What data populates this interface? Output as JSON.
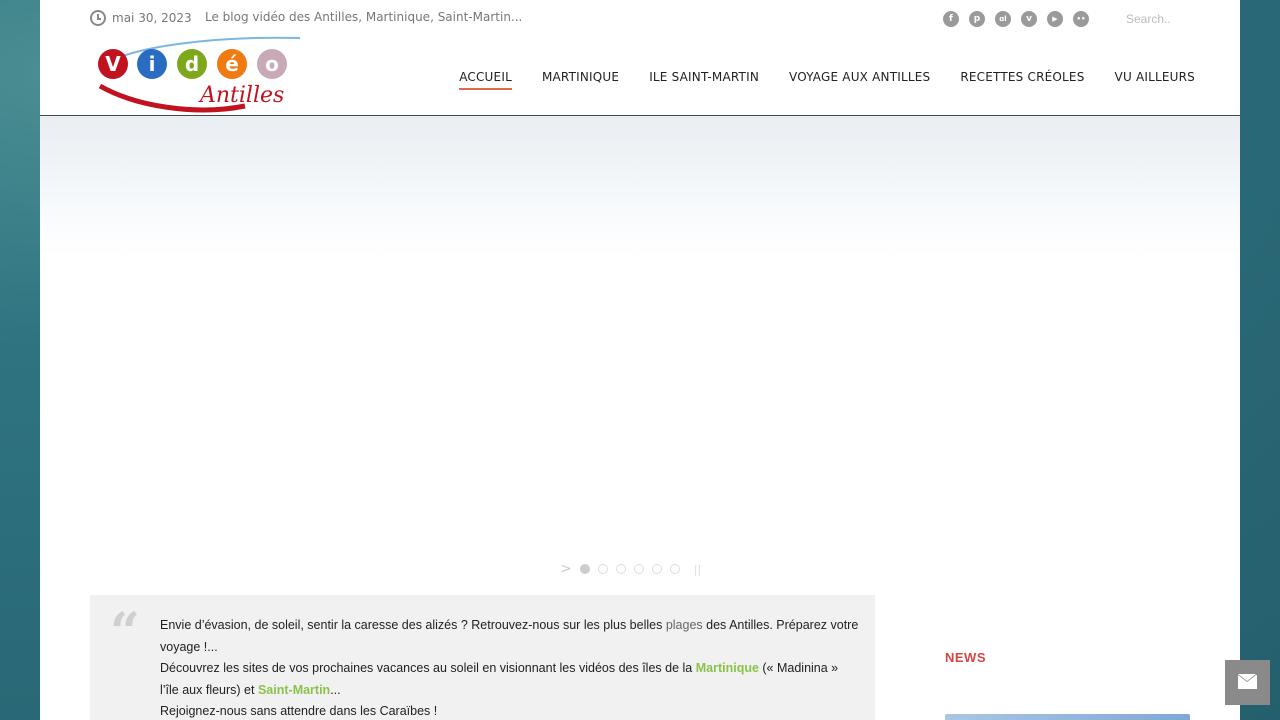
{
  "topbar": {
    "date": "mai 30, 2023",
    "tagline": "Le blog vidéo des Antilles, Martinique, Saint-Martin...",
    "social_icons": [
      "facebook-icon",
      "pinterest-icon",
      "lastfm-icon",
      "vimeo-icon",
      "youtube-icon",
      "flickr-icon"
    ],
    "social_glyphs": [
      "f",
      "p",
      "ɑl",
      "v",
      "▶",
      "••"
    ],
    "search_placeholder": "Search.."
  },
  "logo": {
    "letters": [
      "V",
      "i",
      "d",
      "é",
      "o"
    ],
    "subtitle": "Antilles"
  },
  "nav": {
    "items": [
      "ACCUEIL",
      "MARTINIQUE",
      "ILE SAINT-MARTIN",
      "VOYAGE AUX ANTILLES",
      "RECETTES CRÉOLES",
      "VU AILLEURS"
    ],
    "active": "ACCUEIL"
  },
  "slider": {
    "dots": 6,
    "active_dot": 0
  },
  "intro": {
    "line1_a": "Envie d’évasion, de soleil, sentir la caresse des alizés ? Retrouvez-nous sur les plus belles ",
    "line1_link": "plages",
    "line1_b": " des Antilles. Préparez votre voyage !...",
    "line2_a": "Découvrez les sites de vos prochaines vacances au soleil en visionnant les vidéos des îles de la ",
    "line2_link1": "Martinique",
    "line2_b": "  (« Madinina » l’île aux fleurs) et ",
    "line2_link2": "Saint-Martin",
    "line2_c": "...",
    "line3": "Rejoignez-nous sans attendre dans les Caraïbes !"
  },
  "sidebar": {
    "news_title": "NEWS"
  },
  "colors": {
    "accent": "#e06b4a",
    "news_title": "#d64545",
    "link_green": "#8bc34a"
  }
}
